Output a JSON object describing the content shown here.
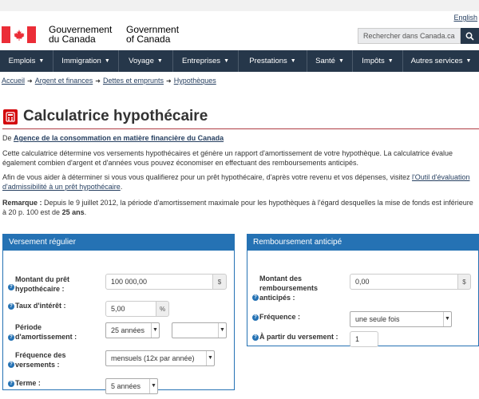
{
  "header": {
    "language_link": "English",
    "signature_fr_line1": "Gouvernement",
    "signature_fr_line2": "du Canada",
    "signature_en_line1": "Government",
    "signature_en_line2": "of Canada",
    "search_placeholder": "Rechercher dans Canada.ca",
    "search_icon": "search-icon"
  },
  "nav": {
    "items": [
      {
        "label": "Emplois"
      },
      {
        "label": "Immigration"
      },
      {
        "label": "Voyage"
      },
      {
        "label": "Entreprises"
      },
      {
        "label": "Prestations"
      },
      {
        "label": "Santé"
      },
      {
        "label": "Impôts"
      },
      {
        "label": "Autres services"
      }
    ]
  },
  "breadcrumb": [
    "Accueil",
    "Argent et finances",
    "Dettes et emprunts",
    "Hypothèques"
  ],
  "page": {
    "title": "Calculatrice hypothécaire",
    "from_prefix": "De ",
    "from_link": "Agence de la consommation en matière financière du Canada",
    "intro_1": "Cette calculatrice détermine vos versements hypothécaires et génère un rapport d'amortissement de votre hypothèque. La calculatrice évalue également combien d'argent et d'années vous pouvez économiser en effectuant des remboursements anticipés.",
    "intro_2_text": "Afin de vous aider à déterminer si vous vous qualifierez pour un prêt hypothécaire, d'après votre revenu et vos dépenses, visitez ",
    "intro_2_link": "l'Outil d'évaluation d'admissibilité à un prêt hypothécaire",
    "intro_2_end": ".",
    "remark_label": "Remarque :",
    "remark_text": " Depuis le 9 juillet 2012, la période d'amortissement maximale pour les hypothèques à l'égard desquelles la mise de fonds est inférieure à 20 p. 100 est de ",
    "remark_bold": "25 ans",
    "remark_end": "."
  },
  "regular_panel": {
    "heading": "Versement régulier",
    "amount_label": "Montant du prêt hypothécaire :",
    "amount_value": "100 000,00",
    "amount_unit": "$",
    "rate_label": "Taux d'intérêt :",
    "rate_value": "5,00",
    "rate_unit": "%",
    "period_label": "Période d'amortissement :",
    "period_years": "25 années",
    "period_months": "",
    "frequency_label": "Fréquence des versements :",
    "frequency_value": "mensuels (12x par année)",
    "term_label": "Terme :",
    "term_value": "5 années"
  },
  "prepay_panel": {
    "heading": "Remboursement anticipé",
    "amount_label": "Montant des remboursements anticipés :",
    "amount_value": "0,00",
    "amount_unit": "$",
    "frequency_label": "Fréquence :",
    "frequency_value": "une seule fois",
    "start_label": "À partir du versement :",
    "start_value": "1"
  },
  "colors": {
    "nav_bg": "#26374a",
    "panel_accent": "#2572b4",
    "flag_red": "#eb2d37",
    "title_rule": "#af3c43"
  }
}
